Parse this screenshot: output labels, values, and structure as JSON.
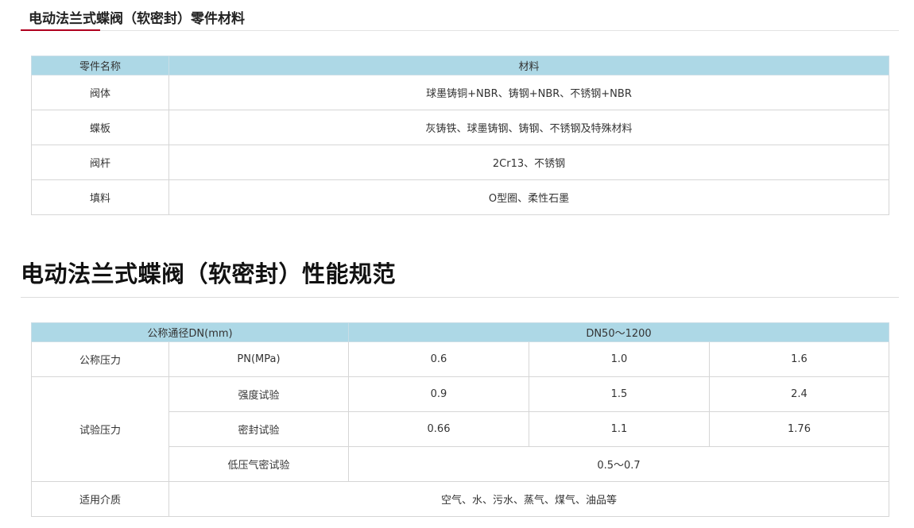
{
  "section1": {
    "title": "电动法兰式蝶阀（软密封）零件材料"
  },
  "materials": {
    "headers": [
      "零件名称",
      "材料"
    ],
    "rows": [
      [
        "阀体",
        "球墨铸铜+NBR、铸钢+NBR、不锈钢+NBR"
      ],
      [
        "蝶板",
        "灰铸铁、球墨铸钢、铸钢、不锈钢及特殊材料"
      ],
      [
        "阀杆",
        "2Cr13、不锈钢"
      ],
      [
        "填料",
        "O型圈、柔性石墨"
      ]
    ]
  },
  "section2": {
    "title": "电动法兰式蝶阀（软密封）性能规范"
  },
  "performance": {
    "header_label": "公称通径DN(mm)",
    "header_value": "DN50～1200",
    "nominal_pressure": {
      "group": "公称压力",
      "label": "PN(MPa)",
      "values": [
        "0.6",
        "1.0",
        "1.6"
      ]
    },
    "test_pressure": {
      "group": "试验压力",
      "strength": {
        "label": "强度试验",
        "values": [
          "0.9",
          "1.5",
          "2.4"
        ]
      },
      "seal": {
        "label": "密封试验",
        "values": [
          "0.66",
          "1.1",
          "1.76"
        ]
      },
      "low_pressure_gas": {
        "label": "低压气密试验",
        "value": "0.5～0.7"
      }
    },
    "media": {
      "label": "适用介质",
      "value": "空气、水、污水、蒸气、煤气、油品等"
    }
  }
}
